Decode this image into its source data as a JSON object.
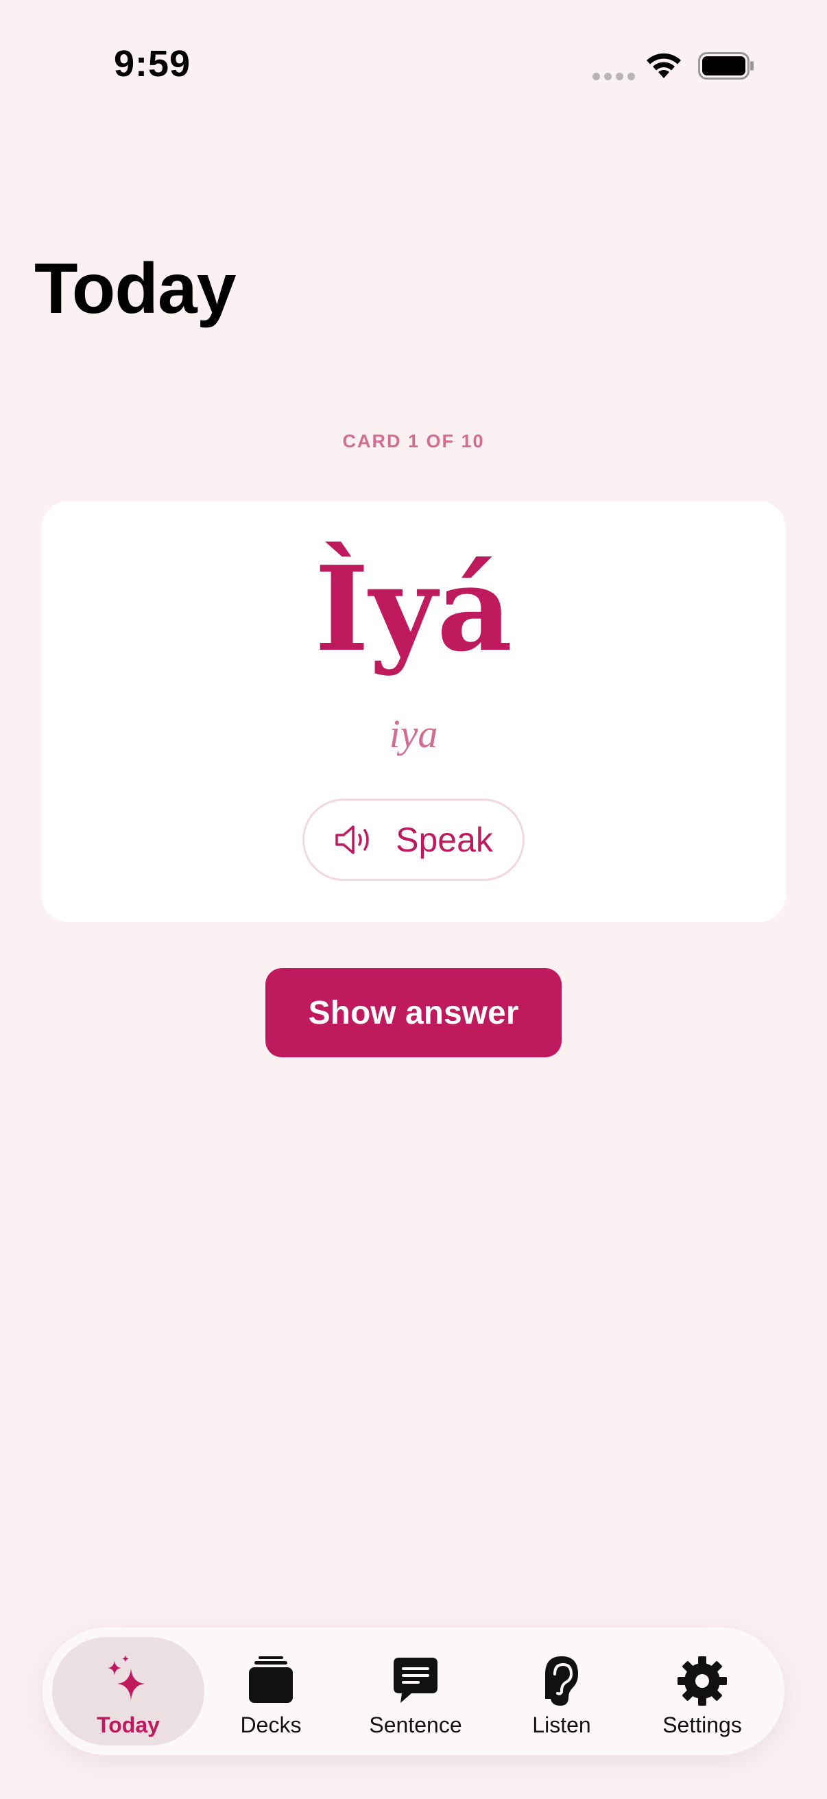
{
  "status_bar": {
    "time": "9:59"
  },
  "page": {
    "title": "Today"
  },
  "card": {
    "counter": "CARD 1 OF 10",
    "word": "Ìyá",
    "romanization": "iya",
    "speak_label": "Speak"
  },
  "actions": {
    "show_answer_label": "Show answer"
  },
  "tab_bar": {
    "active": "Today",
    "items": [
      {
        "label": "Today",
        "icon": "sparkles-icon"
      },
      {
        "label": "Decks",
        "icon": "stack-icon"
      },
      {
        "label": "Sentence",
        "icon": "message-icon"
      },
      {
        "label": "Listen",
        "icon": "ear-icon"
      },
      {
        "label": "Settings",
        "icon": "gear-icon"
      }
    ]
  },
  "colors": {
    "accent": "#bf1a5e",
    "accent_light": "#d16d91",
    "background": "#fbf1f2",
    "card": "#ffffff"
  }
}
